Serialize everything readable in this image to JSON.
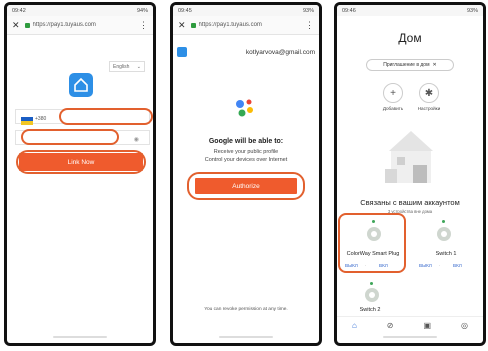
{
  "phone1": {
    "status": {
      "time": "09:42",
      "right": "94%"
    },
    "url": "https://pay1.tuyaus.com",
    "language": "English",
    "country_code": "+380",
    "button_label": "Link Now"
  },
  "phone2": {
    "status": {
      "time": "09:45",
      "right": "93%"
    },
    "url": "https://pay1.tuyaus.com",
    "email": "kotlyarvova@gmail.com",
    "title": "Google will be able to:",
    "line1": "Receive your public profile",
    "line2": "Control your devices over Internet",
    "button_label": "Authorize",
    "footer": "You can revoke permission at any time."
  },
  "phone3": {
    "status": {
      "time": "09:46",
      "right": "93%"
    },
    "title": "Дом",
    "invite_label": "Приглашение в дом",
    "add_label": "Добавить",
    "settings_label": "Настройки",
    "section_title": "Связаны с вашим аккаунтом",
    "section_sub": "3 устройства вне дома",
    "devices": [
      {
        "name": "ColorWay Smart Plug",
        "off": "ВЫКЛ",
        "on": "ВКЛ"
      },
      {
        "name": "Switch 1",
        "off": "ВЫКЛ",
        "on": "ВКЛ"
      },
      {
        "name": "Switch 2"
      }
    ]
  },
  "colors": {
    "accent": "#ef5b2d",
    "highlight": "#e2602e",
    "link": "#3366cc"
  }
}
